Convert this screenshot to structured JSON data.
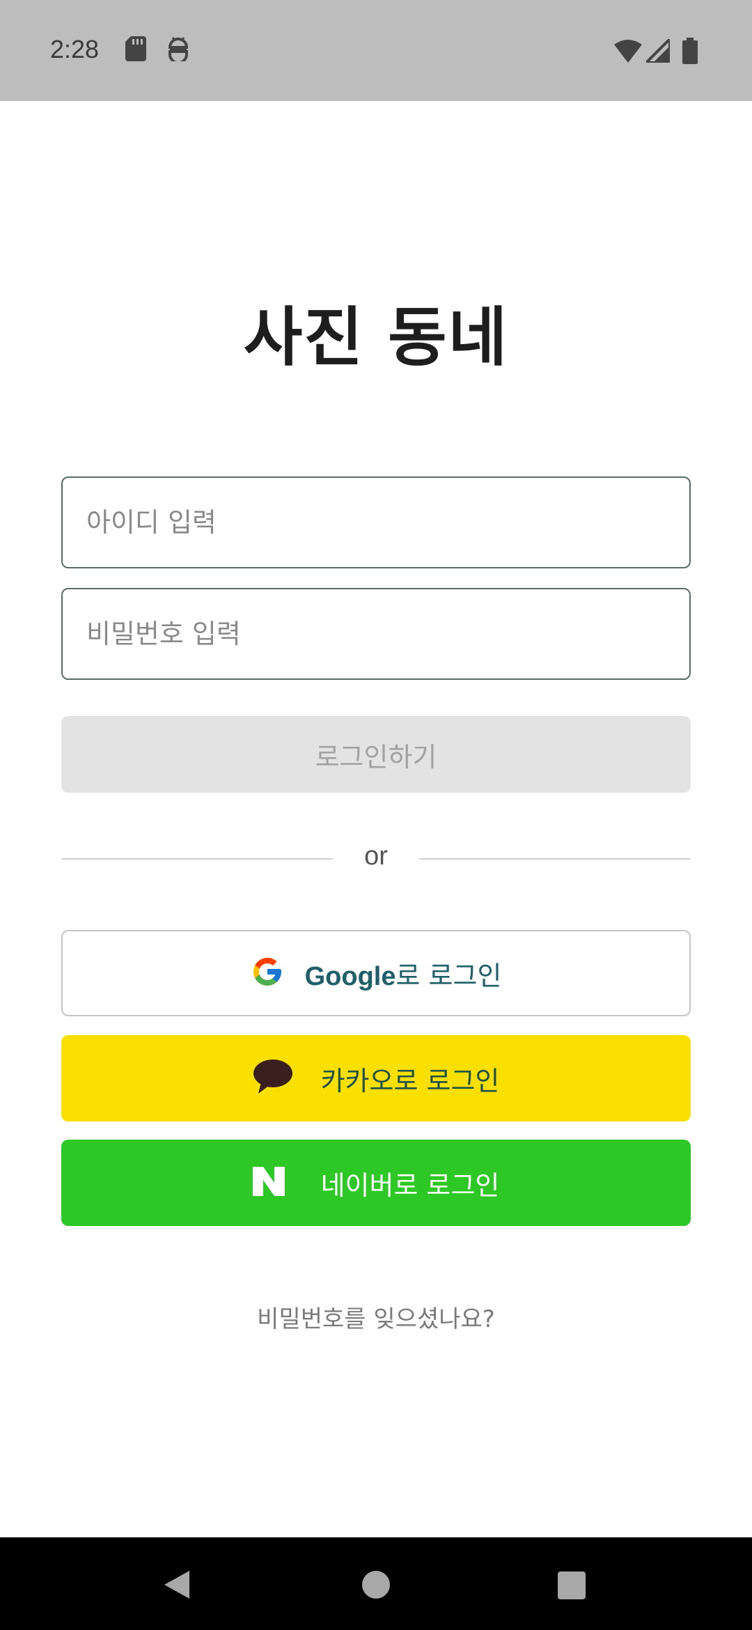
{
  "status_bar": {
    "time": "2:28",
    "icons": [
      "sd-card-icon",
      "android-robot-icon",
      "wifi-icon",
      "cell-signal-icon",
      "battery-icon"
    ],
    "background": "#bdbdbd"
  },
  "app": {
    "title": "사진 동네"
  },
  "login_form": {
    "id_placeholder": "아이디 입력",
    "id_value": "",
    "password_placeholder": "비밀번호 입력",
    "password_value": "",
    "login_button_label": "로그인하기"
  },
  "divider": {
    "label": "or"
  },
  "social_login": {
    "google": {
      "brand": "Google",
      "suffix": "로 로그인",
      "icon": "google-icon",
      "background": "#ffffff"
    },
    "kakao": {
      "label": "카카오로 로그인",
      "icon": "kakao-talk-icon",
      "background": "#f9e000"
    },
    "naver": {
      "label": "네이버로 로그인",
      "icon": "naver-n-icon",
      "background": "#2dc826"
    }
  },
  "forgot_password": {
    "label": "비밀번호를 잊으셨나요?"
  },
  "nav_bar": {
    "icons": [
      "back-icon",
      "home-icon",
      "recents-icon"
    ]
  }
}
